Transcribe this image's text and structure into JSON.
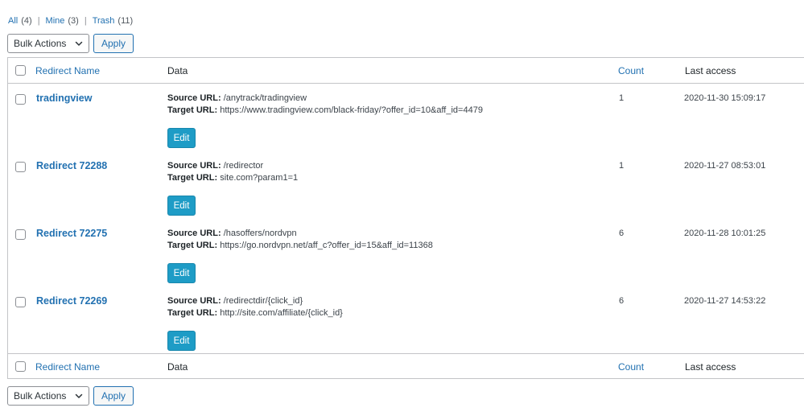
{
  "filters": [
    {
      "label": "All",
      "count": "(4)"
    },
    {
      "label": "Mine",
      "count": "(3)"
    },
    {
      "label": "Trash",
      "count": "(11)"
    }
  ],
  "separator": "|",
  "bulk_actions": {
    "selected": "Bulk Actions",
    "apply_label": "Apply"
  },
  "columns": {
    "name": "Redirect Name",
    "data": "Data",
    "count": "Count",
    "last_access": "Last access"
  },
  "labels": {
    "source": "Source URL:",
    "target": "Target URL:",
    "edit": "Edit"
  },
  "rows": [
    {
      "name": "tradingview",
      "source": "/anytrack/tradingview",
      "target": "https://www.tradingview.com/black-friday/?offer_id=10&aff_id=4479",
      "count": "1",
      "last_access": "2020-11-30 15:09:17"
    },
    {
      "name": "Redirect 72288",
      "source": "/redirector",
      "target": "site.com?param1=1",
      "count": "1",
      "last_access": "2020-11-27 08:53:01"
    },
    {
      "name": "Redirect 72275",
      "source": "/hasoffers/nordvpn",
      "target": "https://go.nordvpn.net/aff_c?offer_id=15&aff_id=11368",
      "count": "6",
      "last_access": "2020-11-28 10:01:25"
    },
    {
      "name": "Redirect 72269",
      "source": "/redirectdir/{click_id}",
      "target": "http://site.com/affiliate/{click_id}",
      "count": "6",
      "last_access": "2020-11-27 14:53:22"
    }
  ],
  "colors": {
    "link": "#2271b1",
    "edit_button": "#1e9cc6",
    "border": "#c3c4c7"
  },
  "icons": {
    "dropdown": "chevron-down-icon"
  }
}
